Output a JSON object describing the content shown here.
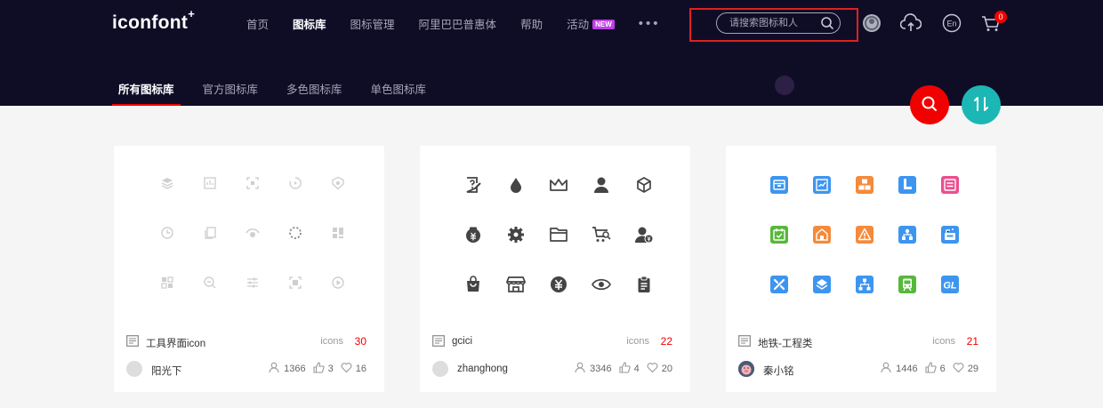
{
  "header": {
    "logo": "iconfont",
    "logo_mark": "+",
    "nav": [
      {
        "label": "首页",
        "active": false
      },
      {
        "label": "图标库",
        "active": true
      },
      {
        "label": "图标管理",
        "active": false
      },
      {
        "label": "阿里巴巴普惠体",
        "active": false
      },
      {
        "label": "帮助",
        "active": false
      },
      {
        "label": "活动",
        "active": false,
        "badge": "NEW"
      }
    ],
    "more": "•••",
    "search_placeholder": "请搜索图标和人",
    "cart_count": "0",
    "lang": "En"
  },
  "subnav": [
    {
      "label": "所有图标库",
      "active": true
    },
    {
      "label": "官方图标库",
      "active": false
    },
    {
      "label": "多色图标库",
      "active": false
    },
    {
      "label": "单色图标库",
      "active": false
    }
  ],
  "cards": [
    {
      "name": "工具界面icon",
      "icons_label": "icons",
      "icons_count": "30",
      "user": "阳光下",
      "collects": "1366",
      "likes": "3",
      "favorites": "16",
      "style": "light"
    },
    {
      "name": "gcici",
      "icons_label": "icons",
      "icons_count": "22",
      "user": "zhanghong",
      "collects": "3346",
      "likes": "4",
      "favorites": "20",
      "style": "dark"
    },
    {
      "name": "地铁-工程类",
      "icons_label": "icons",
      "icons_count": "21",
      "user": "秦小铭",
      "collects": "1446",
      "likes": "6",
      "favorites": "29",
      "style": "color"
    }
  ],
  "colors": {
    "header_bg": "#0f0d26",
    "accent_red": "#f20000",
    "accent_teal": "#1cb7b4"
  }
}
